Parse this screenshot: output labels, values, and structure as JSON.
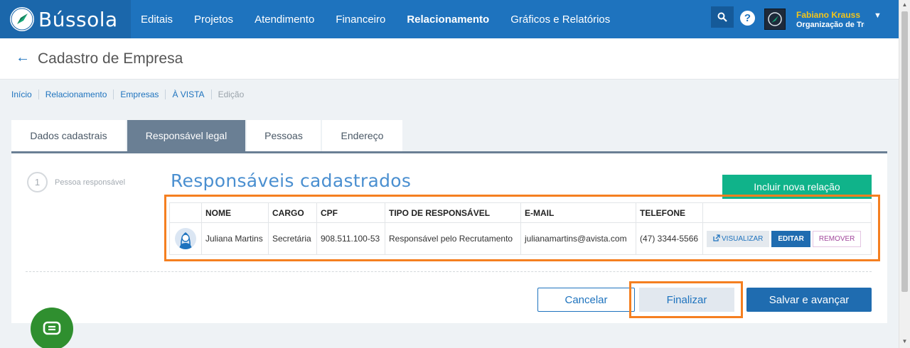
{
  "app": {
    "logo_text": "Bússola",
    "logo_icon": "compass-icon"
  },
  "nav": {
    "items": [
      "Editais",
      "Projetos",
      "Atendimento",
      "Financeiro",
      "Relacionamento",
      "Gráficos e Relatórios"
    ],
    "active": "Relacionamento"
  },
  "header_icons": {
    "search": "search-icon",
    "help": "?"
  },
  "user": {
    "name": "Fabiano Krauss",
    "organization": "Organização de Tre"
  },
  "page": {
    "back_icon": "←",
    "title": "Cadastro de Empresa"
  },
  "breadcrumb": [
    "Início",
    "Relacionamento",
    "Empresas",
    "À VISTA",
    "Edição"
  ],
  "tabs": [
    "Dados cadastrais",
    "Responsável legal",
    "Pessoas",
    "Endereço"
  ],
  "active_tab": "Responsável legal",
  "step": {
    "number": "1",
    "label": "Pessoa responsável"
  },
  "section": {
    "title": "Responsáveis cadastrados",
    "add_button": "Incluir nova relação"
  },
  "table": {
    "headers": [
      "",
      "NOME",
      "CARGO",
      "CPF",
      "TIPO DE RESPONSÁVEL",
      "E-MAIL",
      "TELEFONE",
      ""
    ],
    "rows": [
      {
        "avatar": "person-icon",
        "nome": "Juliana Martins",
        "cargo": "Secretária",
        "cpf": "908.511.100-53",
        "tipo": "Responsável pelo Recrutamento",
        "email": "julianamartins@avista.com",
        "telefone": "(47) 3344-5566",
        "actions": {
          "view": "VISUALIZAR",
          "edit": "EDITAR",
          "remove": "REMOVER"
        }
      }
    ]
  },
  "footer_buttons": {
    "cancel": "Cancelar",
    "finish": "Finalizar",
    "save_next": "Salvar e avançar"
  },
  "colors": {
    "primary": "#1e73be",
    "accent_green": "#10b38a",
    "highlight": "#f57f20",
    "tab_active": "#6a7f94",
    "user_name": "#f5c518"
  },
  "chat": {
    "icon": "chat-icon"
  }
}
